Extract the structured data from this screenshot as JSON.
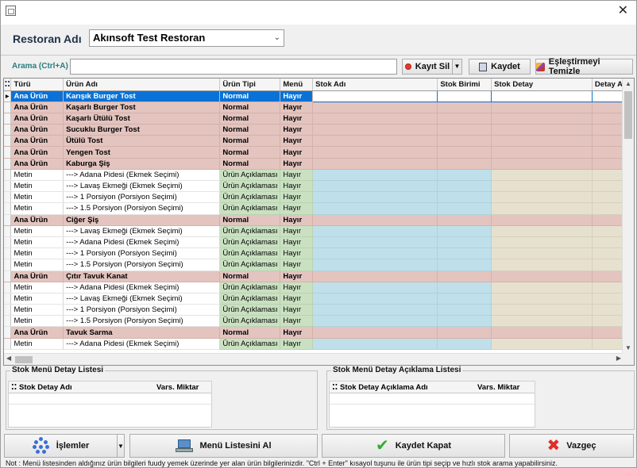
{
  "window": {
    "close_glyph": "✕"
  },
  "header": {
    "restoran_label": "Restoran Adı",
    "restoran_value": "Akınsoft Test Restoran",
    "search_label": "Arama (Ctrl+A)",
    "search_value": ""
  },
  "toolbar": {
    "kayit_sil": "Kayıt Sil",
    "kaydet": "Kaydet",
    "eslestirme_temizle": "Eşleştirmeyi Temizle"
  },
  "grid": {
    "columns": [
      "Türü",
      "Ürün Adı",
      "Ürün Tipi",
      "Menü",
      "Stok Adı",
      "Stok Birimi",
      "Stok Detay",
      "Detay A"
    ],
    "rows": [
      {
        "type": "ana",
        "cells": [
          "Ana Ürün",
          "Karışık Burger Tost",
          "Normal",
          "Hayır",
          "",
          "",
          "",
          ""
        ],
        "selected": true
      },
      {
        "type": "ana",
        "cells": [
          "Ana Ürün",
          "Kaşarlı Burger Tost",
          "Normal",
          "Hayır",
          "",
          "",
          "",
          ""
        ]
      },
      {
        "type": "ana",
        "cells": [
          "Ana Ürün",
          "Kaşarlı Ütülü Tost",
          "Normal",
          "Hayır",
          "",
          "",
          "",
          ""
        ]
      },
      {
        "type": "ana",
        "cells": [
          "Ana Ürün",
          "Sucuklu Burger Tost",
          "Normal",
          "Hayır",
          "",
          "",
          "",
          ""
        ]
      },
      {
        "type": "ana",
        "cells": [
          "Ana Ürün",
          "Ütülü Tost",
          "Normal",
          "Hayır",
          "",
          "",
          "",
          ""
        ]
      },
      {
        "type": "ana",
        "cells": [
          "Ana Ürün",
          "Yengen Tost",
          "Normal",
          "Hayır",
          "",
          "",
          "",
          ""
        ]
      },
      {
        "type": "ana",
        "cells": [
          "Ana Ürün",
          "Kaburga Şiş",
          "Normal",
          "Hayır",
          "",
          "",
          "",
          ""
        ]
      },
      {
        "type": "met",
        "cells": [
          "Metin",
          "---> Adana Pidesi (Ekmek Seçimi)",
          "Ürün Açıklaması",
          "Hayır",
          "",
          "",
          "",
          ""
        ]
      },
      {
        "type": "met",
        "cells": [
          "Metin",
          "---> Lavaş Ekmeği (Ekmek Seçimi)",
          "Ürün Açıklaması",
          "Hayır",
          "",
          "",
          "",
          ""
        ]
      },
      {
        "type": "met",
        "cells": [
          "Metin",
          "---> 1 Porsiyon (Porsiyon Seçimi)",
          "Ürün Açıklaması",
          "Hayır",
          "",
          "",
          "",
          ""
        ]
      },
      {
        "type": "met",
        "cells": [
          "Metin",
          "---> 1.5 Porsiyon (Porsiyon Seçimi)",
          "Ürün Açıklaması",
          "Hayır",
          "",
          "",
          "",
          ""
        ]
      },
      {
        "type": "ana",
        "cells": [
          "Ana Ürün",
          "Ciğer Şiş",
          "Normal",
          "Hayır",
          "",
          "",
          "",
          ""
        ]
      },
      {
        "type": "met",
        "cells": [
          "Metin",
          "---> Lavaş Ekmeği (Ekmek Seçimi)",
          "Ürün Açıklaması",
          "Hayır",
          "",
          "",
          "",
          ""
        ]
      },
      {
        "type": "met",
        "cells": [
          "Metin",
          "---> Adana Pidesi (Ekmek Seçimi)",
          "Ürün Açıklaması",
          "Hayır",
          "",
          "",
          "",
          ""
        ]
      },
      {
        "type": "met",
        "cells": [
          "Metin",
          "---> 1 Porsiyon (Porsiyon Seçimi)",
          "Ürün Açıklaması",
          "Hayır",
          "",
          "",
          "",
          ""
        ]
      },
      {
        "type": "met",
        "cells": [
          "Metin",
          "---> 1.5 Porsiyon (Porsiyon Seçimi)",
          "Ürün Açıklaması",
          "Hayır",
          "",
          "",
          "",
          ""
        ]
      },
      {
        "type": "ana",
        "cells": [
          "Ana Ürün",
          "Çıtır Tavuk Kanat",
          "Normal",
          "Hayır",
          "",
          "",
          "",
          ""
        ]
      },
      {
        "type": "met",
        "cells": [
          "Metin",
          "---> Adana Pidesi (Ekmek Seçimi)",
          "Ürün Açıklaması",
          "Hayır",
          "",
          "",
          "",
          ""
        ]
      },
      {
        "type": "met",
        "cells": [
          "Metin",
          "---> Lavaş Ekmeği (Ekmek Seçimi)",
          "Ürün Açıklaması",
          "Hayır",
          "",
          "",
          "",
          ""
        ]
      },
      {
        "type": "met",
        "cells": [
          "Metin",
          "---> 1 Porsiyon (Porsiyon Seçimi)",
          "Ürün Açıklaması",
          "Hayır",
          "",
          "",
          "",
          ""
        ]
      },
      {
        "type": "met",
        "cells": [
          "Metin",
          "---> 1.5 Porsiyon (Porsiyon Seçimi)",
          "Ürün Açıklaması",
          "Hayır",
          "",
          "",
          "",
          ""
        ]
      },
      {
        "type": "ana",
        "cells": [
          "Ana Ürün",
          "Tavuk Sarma",
          "Normal",
          "Hayır",
          "",
          "",
          "",
          ""
        ]
      },
      {
        "type": "met",
        "cells": [
          "Metin",
          "---> Adana Pidesi (Ekmek Seçimi)",
          "Ürün Açıklaması",
          "Hayır",
          "",
          "",
          "",
          ""
        ]
      }
    ]
  },
  "detail_left": {
    "title": "Stok Menü Detay Listesi",
    "col1": "Stok Detay Adı",
    "col2": "Vars. Miktar"
  },
  "detail_right": {
    "title": "Stok Menü Detay Açıklama Listesi",
    "col1": "Stok Detay Açıklama Adı",
    "col2": "Vars. Miktar"
  },
  "footer": {
    "islemler": "İşlemler",
    "menu_listesi": "Menü Listesini Al",
    "kaydet_kapat": "Kaydet Kapat",
    "vazgec": "Vazgeç",
    "note": "Not :  Menü listesinden aldığınız ürün bilgileri fuudy yemek üzerinde yer alan ürün bilgilerinizdir. \"Ctrl + Enter\" kısayol tuşunu ile ürün tipi seçip ve hızlı stok arama yapabilirsiniz."
  }
}
